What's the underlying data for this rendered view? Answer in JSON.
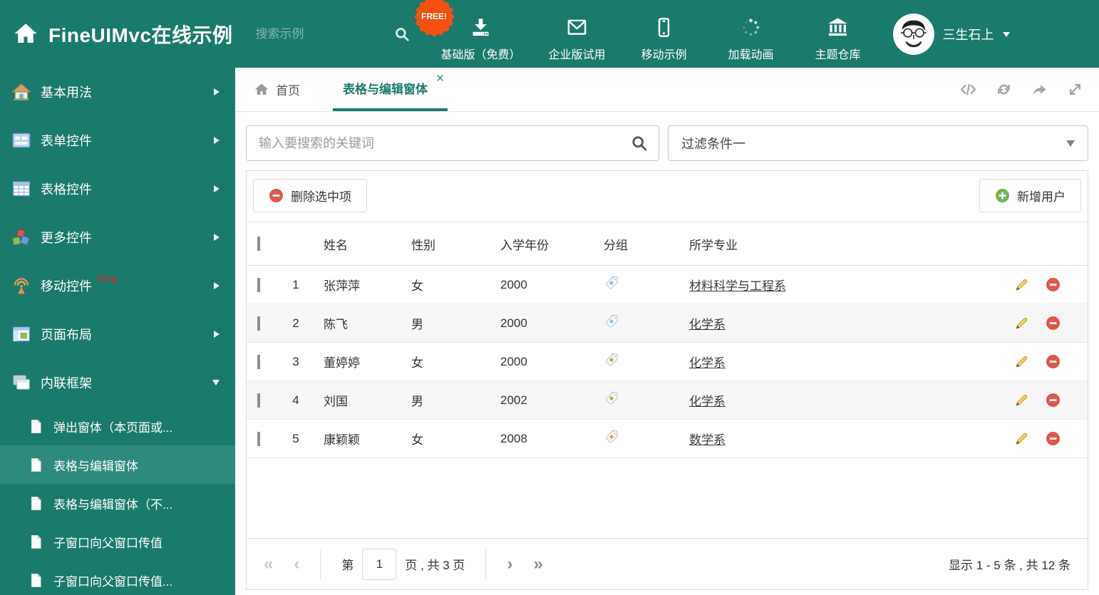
{
  "header": {
    "title": "FineUIMvc在线示例",
    "search_placeholder": "搜索示例",
    "free_badge": "FREE!",
    "nav": [
      {
        "name": "basic-free",
        "icon": "download",
        "label": "基础版（免费）",
        "badge": true
      },
      {
        "name": "enterprise-trial",
        "icon": "envelope",
        "label": "企业版试用"
      },
      {
        "name": "mobile-demo",
        "icon": "mobile",
        "label": "移动示例"
      },
      {
        "name": "loading-animation",
        "icon": "spinner",
        "label": "加载动画"
      },
      {
        "name": "theme-repo",
        "icon": "bank",
        "label": "主题仓库"
      }
    ],
    "user_name": "三生石上"
  },
  "sidebar": {
    "items": [
      {
        "name": "basic-usage",
        "icon": "house",
        "label": "基本用法"
      },
      {
        "name": "form-controls",
        "icon": "form",
        "label": "表单控件"
      },
      {
        "name": "table-controls",
        "icon": "grid",
        "label": "表格控件"
      },
      {
        "name": "more-controls",
        "icon": "cubes",
        "label": "更多控件"
      },
      {
        "name": "mobile-controls",
        "icon": "antenna",
        "label": "移动控件",
        "corp": "Corp."
      },
      {
        "name": "page-layout",
        "icon": "layout",
        "label": "页面布局"
      },
      {
        "name": "inline-frame",
        "icon": "frames",
        "label": "内联框架",
        "expanded": true
      }
    ],
    "subitems": [
      {
        "name": "popup-window",
        "label": "弹出窗体（本页面或..."
      },
      {
        "name": "grid-edit-window",
        "label": "表格与编辑窗体",
        "selected": true
      },
      {
        "name": "grid-edit-window-no",
        "label": "表格与编辑窗体（不..."
      },
      {
        "name": "child-to-parent",
        "label": "子窗口向父窗口传值"
      },
      {
        "name": "child-to-parent-2",
        "label": "子窗口向父窗口传值..."
      }
    ]
  },
  "tabs": {
    "home": "首页",
    "active": "表格与编辑窗体",
    "tools": [
      "code",
      "refresh",
      "share",
      "expand"
    ]
  },
  "filterbar": {
    "search_placeholder": "输入要搜索的关键词",
    "filter_value": "过滤条件一"
  },
  "toolbar": {
    "delete_label": "删除选中项",
    "add_label": "新增用户"
  },
  "table": {
    "columns": {
      "name": "姓名",
      "gender": "性别",
      "year": "入学年份",
      "group": "分组",
      "major": "所学专业"
    },
    "rows": [
      {
        "index": "1",
        "name": "张萍萍",
        "gender": "女",
        "year": "2000",
        "tag": "blue",
        "major": "材料科学与工程系"
      },
      {
        "index": "2",
        "name": "陈飞",
        "gender": "男",
        "year": "2000",
        "tag": "blue",
        "major": "化学系"
      },
      {
        "index": "3",
        "name": "董婷婷",
        "gender": "女",
        "year": "2000",
        "tag": "green",
        "major": "化学系"
      },
      {
        "index": "4",
        "name": "刘国",
        "gender": "男",
        "year": "2002",
        "tag": "green",
        "major": "化学系"
      },
      {
        "index": "5",
        "name": "康颖颖",
        "gender": "女",
        "year": "2008",
        "tag": "orange",
        "major": "数学系"
      }
    ]
  },
  "pagination": {
    "prefix": "第",
    "page": "1",
    "suffix": "页 , 共 3 页",
    "summary": "显示 1 - 5 条 , 共 12 条",
    "glyphs": {
      "first": "«",
      "prev": "‹",
      "next": "›",
      "last": "»"
    }
  },
  "colors": {
    "theme": "#1a7a6b",
    "selected": "#2e8a7c",
    "free_badge": "#f4500f",
    "tag_blue": "#85c1ed",
    "tag_green": "#8dc153",
    "tag_orange": "#f4a15d"
  }
}
